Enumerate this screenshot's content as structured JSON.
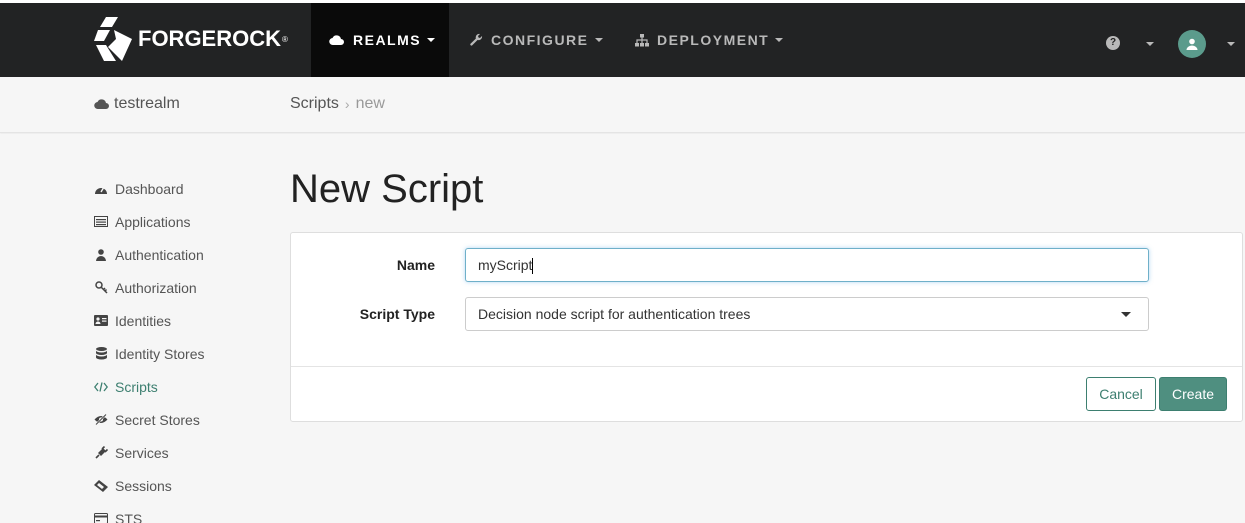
{
  "brand": {
    "name": "FORGEROCK",
    "trademark": "®"
  },
  "nav": {
    "items": [
      {
        "label": "REALMS",
        "icon": "cloud-icon",
        "active": true
      },
      {
        "label": "CONFIGURE",
        "icon": "wrench-icon",
        "active": false
      },
      {
        "label": "DEPLOYMENT",
        "icon": "sitemap-icon",
        "active": false
      }
    ],
    "help_icon": "question-circle-icon",
    "user_icon": "user-icon"
  },
  "subheader": {
    "realm": "testrealm",
    "breadcrumb": {
      "parent": "Scripts",
      "current": "new"
    }
  },
  "sidebar": {
    "items": [
      {
        "label": "Dashboard",
        "icon": "dashboard-icon"
      },
      {
        "label": "Applications",
        "icon": "list-alt-icon"
      },
      {
        "label": "Authentication",
        "icon": "user-icon"
      },
      {
        "label": "Authorization",
        "icon": "key-icon"
      },
      {
        "label": "Identities",
        "icon": "id-card-icon"
      },
      {
        "label": "Identity Stores",
        "icon": "database-icon"
      },
      {
        "label": "Scripts",
        "icon": "code-icon",
        "active": true
      },
      {
        "label": "Secret Stores",
        "icon": "eye-slash-icon"
      },
      {
        "label": "Services",
        "icon": "plug-icon"
      },
      {
        "label": "Sessions",
        "icon": "ticket-icon"
      },
      {
        "label": "STS",
        "icon": "credit-card-icon"
      }
    ]
  },
  "main": {
    "title": "New Script",
    "form": {
      "name_label": "Name",
      "name_value": "myScript",
      "type_label": "Script Type",
      "type_value": "Decision node script for authentication trees"
    },
    "cancel_label": "Cancel",
    "create_label": "Create"
  },
  "colors": {
    "topbar": "#222324",
    "accent": "#4f8f80",
    "active_nav": "#0a0a0a"
  }
}
